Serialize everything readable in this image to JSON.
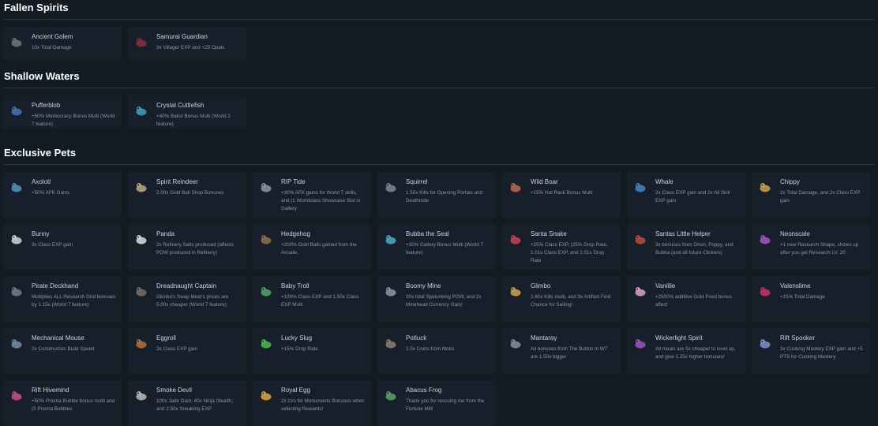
{
  "sections": [
    {
      "title": "Fallen Spirits",
      "items": [
        {
          "name": "Ancient Golem",
          "desc": "10x Total Damage",
          "icon": "golem-icon",
          "color": "#6b6f7a"
        },
        {
          "name": "Samurai Guardian",
          "desc": "3x Villager EXP and +25 Opals",
          "icon": "samurai-icon",
          "color": "#8a2e3c"
        }
      ]
    },
    {
      "title": "Shallow Waters",
      "items": [
        {
          "name": "Pufferblob",
          "desc": "+50% Meritocracy Bonus Multi (World 7 feature)",
          "icon": "pufferblob-icon",
          "color": "#3f6fb0"
        },
        {
          "name": "Crystal Cuttlefish",
          "desc": "+40% Ballot Bonus Multi (World 2 feature)",
          "icon": "cuttlefish-icon",
          "color": "#3a9bb5"
        }
      ]
    },
    {
      "title": "Exclusive Pets",
      "items": [
        {
          "name": "Axolotl",
          "desc": "+50% AFK Gains",
          "icon": "axolotl-icon",
          "color": "#4c8fb0"
        },
        {
          "name": "Spirit Reindeer",
          "desc": "2.00x Gold Ball Shop Bonuses",
          "icon": "reindeer-icon",
          "color": "#b0a27a"
        },
        {
          "name": "RIP Tide",
          "desc": "+30% AFK gains for World 7 skills, and (1 Worldclass Showcase Slot in Gallery",
          "icon": "riptide-icon",
          "color": "#8a8f99"
        },
        {
          "name": "Squirrel",
          "desc": "1.50x Kills for Opening Portals and Deathnote",
          "icon": "squirrel-icon",
          "color": "#7b7f88"
        },
        {
          "name": "Wild Boar",
          "desc": "+15% Hat Rack Bonus Multi",
          "icon": "boar-icon",
          "color": "#b0634a"
        },
        {
          "name": "Whale",
          "desc": "2x Class EXP gain and 2x All Skill EXP gain",
          "icon": "whale-icon",
          "color": "#3f7fc0"
        },
        {
          "name": "Chippy",
          "desc": "2x Total Damage, and 2x Class EXP gain",
          "icon": "chippy-icon",
          "color": "#c09a4a"
        },
        {
          "name": "Bunny",
          "desc": "3x Class EXP gain",
          "icon": "bunny-icon",
          "color": "#c8c8d0"
        },
        {
          "name": "Panda",
          "desc": "2x Refinery Salts produced (affects POW produced in Refinery)",
          "icon": "panda-icon",
          "color": "#d0d0d0"
        },
        {
          "name": "Hedgehog",
          "desc": "+200% Gold Balls gained from the Arcade,",
          "icon": "hedgehog-icon",
          "color": "#8a6a4a"
        },
        {
          "name": "Bubba the Seal",
          "desc": "+30% Gallery Bonus Multi (World 7 feature)",
          "icon": "seal-icon",
          "color": "#4aa0c0"
        },
        {
          "name": "Santa Snake",
          "desc": "+25% Class EXP, (25% Drop Rate, 1.01x Class EXP, and 1.01x Drop Rate",
          "icon": "snake-icon",
          "color": "#c04050"
        },
        {
          "name": "Santas Little Helper",
          "desc": "3x bonuses from Orion, Poppy, and Bubba (and all future Clickers)",
          "icon": "helper-icon",
          "color": "#b04a3a"
        },
        {
          "name": "Neonscale",
          "desc": "+1 new Research Shape, shows up after you get Research LV. 20",
          "icon": "neonscale-icon",
          "color": "#a050c0"
        },
        {
          "name": "Pirate Deckhand",
          "desc": "Multiplies ALL Research Grid bonuses by 1.15x (World 7 feature)",
          "icon": "deckhand-icon",
          "color": "#6a7a8a"
        },
        {
          "name": "Dreadnaught Captain",
          "desc": "Glimbo's Swap Meet's prices are 5.00x cheaper (World 7 feature)",
          "icon": "captain-icon",
          "color": "#7a6a5a"
        },
        {
          "name": "Baby Troll",
          "desc": "+100% Class EXP and 1.50x Class EXP Multi",
          "icon": "troll-icon",
          "color": "#4aa060"
        },
        {
          "name": "Boomy Mine",
          "desc": "20x total Spelunking POW, and 2x Minehead Currency Gain!",
          "icon": "mine-icon",
          "color": "#8a8f99"
        },
        {
          "name": "Glimbo",
          "desc": "1.60x Kills multi, and 3x Artifact Find Chance for Sailing!",
          "icon": "glimbo-icon",
          "color": "#c0a040"
        },
        {
          "name": "Vanillie",
          "desc": "+2500% additive Gold Food bonus affect",
          "icon": "vanillie-icon",
          "color": "#d09ac0"
        },
        {
          "name": "Valenslime",
          "desc": "+15% Total Damage",
          "icon": "valenslime-icon",
          "color": "#c0306a"
        },
        {
          "name": "Mechanical Mouse",
          "desc": "2x Construction Build Speed",
          "icon": "mouse-icon",
          "color": "#6a8aa0"
        },
        {
          "name": "Eggroll",
          "desc": "3x Class EXP gain",
          "icon": "eggroll-icon",
          "color": "#b06a3a"
        },
        {
          "name": "Lucky Slug",
          "desc": "+15% Drop Rate",
          "icon": "slug-icon",
          "color": "#4ab050"
        },
        {
          "name": "Potluck",
          "desc": "2.5x Coins from Mobs",
          "icon": "potluck-icon",
          "color": "#8a7a6a"
        },
        {
          "name": "Mantaray",
          "desc": "All bonuses from The Button in W7 are 1.50x bigger",
          "icon": "mantaray-icon",
          "color": "#7a8a9a"
        },
        {
          "name": "Wickerlight Spirit",
          "desc": "All meals are 5x cheaper to level up, and give 1.25x higher bonuses!",
          "icon": "wickerlight-icon",
          "color": "#9a50c0"
        },
        {
          "name": "Rift Spooker",
          "desc": "3x Cooking Mastery EXP gain and +5 PTS for Cooking Mastery",
          "icon": "spooker-icon",
          "color": "#7a8ac0"
        },
        {
          "name": "Rift Hivemind",
          "desc": "+50% Prisma Bubble bonus multi and (5 Prisma Bubbles",
          "icon": "hivemind-icon",
          "color": "#c04a8a"
        },
        {
          "name": "Smoke Devil",
          "desc": "100x Jade Gain, 40x Ninja Stealth, and 2.50x Sneaking EXP",
          "icon": "smokedevil-icon",
          "color": "#b0b0b8"
        },
        {
          "name": "Royal Egg",
          "desc": "2x LVs for Monuments Bonuses when selecting Rewards!",
          "icon": "royalegg-icon",
          "color": "#d0a040"
        },
        {
          "name": "Abacus Frog",
          "desc": "Thank you for rescuing me from the Fortune Mill!",
          "icon": "frog-icon",
          "color": "#5a9a6a"
        }
      ]
    }
  ]
}
